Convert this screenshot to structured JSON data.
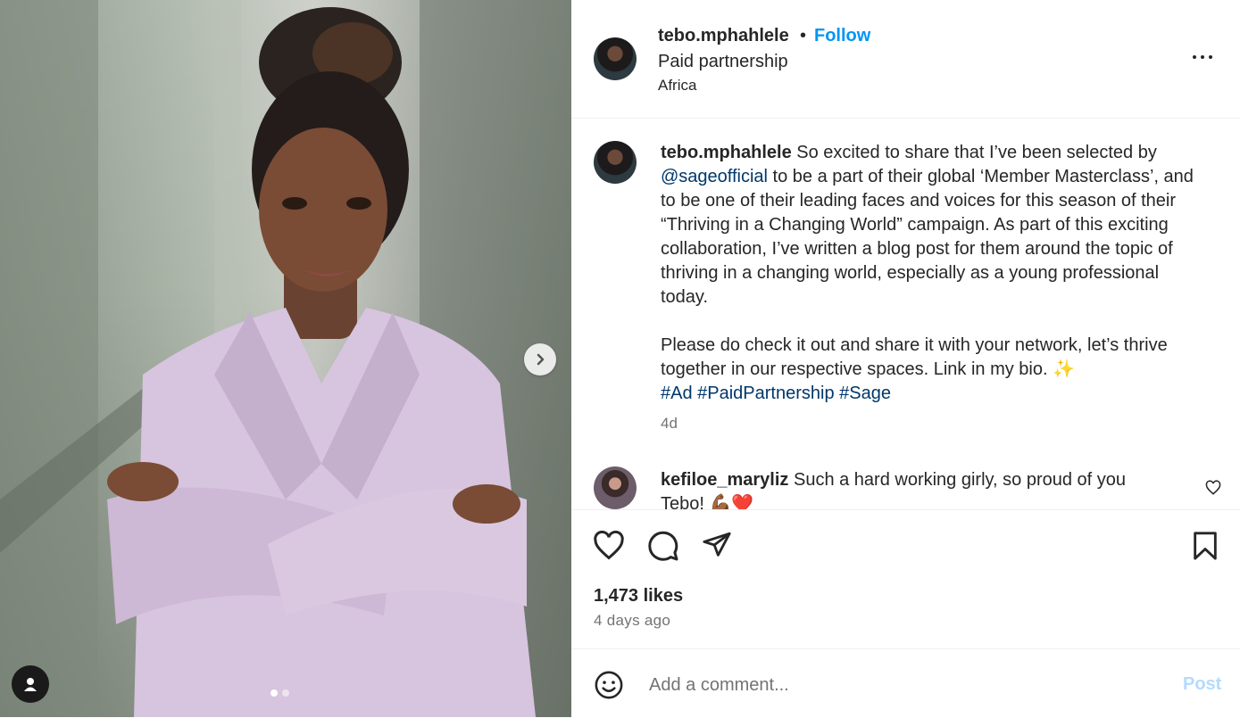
{
  "post": {
    "username": "tebo.mphahlele",
    "follow_label": "Follow",
    "bullet": "•",
    "partnership_label": "Paid partnership",
    "location": "Africa",
    "more_icon": "more-horizontal-icon"
  },
  "caption": {
    "username": "tebo.mphahlele",
    "text_1": " So excited to share that I’ve been selected by ",
    "mention": "@sageofficial",
    "text_2": " to be a part of their global ‘Member Masterclass’, and to be one of their leading faces and voices for this season of their “Thriving in a Changing World” campaign. As part of this exciting collaboration, I’ve written a blog post for them around the topic of thriving in a changing world, especially as a young professional today.",
    "text_3": "Please do check it out and share it with your network, let’s thrive together in our respective spaces. Link in my bio. ",
    "sparkle": "✨",
    "hashtags": [
      "#Ad",
      "#PaidPartnership",
      "#Sage"
    ],
    "time": "4d"
  },
  "comment": {
    "username": "kefiloe_maryliz",
    "text": " Such a hard working girly, so proud of you Tebo! ",
    "emoji": "💪🏾❤️"
  },
  "actions": {
    "likes": "1,473 likes",
    "posted_ago": "4 days ago"
  },
  "composer": {
    "placeholder": "Add a comment...",
    "post_label": "Post"
  },
  "carousel": {
    "total": 2,
    "current": 1
  },
  "colors": {
    "follow": "#0095f6",
    "link": "#00376b",
    "post_disabled": "#b3dbff",
    "muted": "#737373"
  }
}
